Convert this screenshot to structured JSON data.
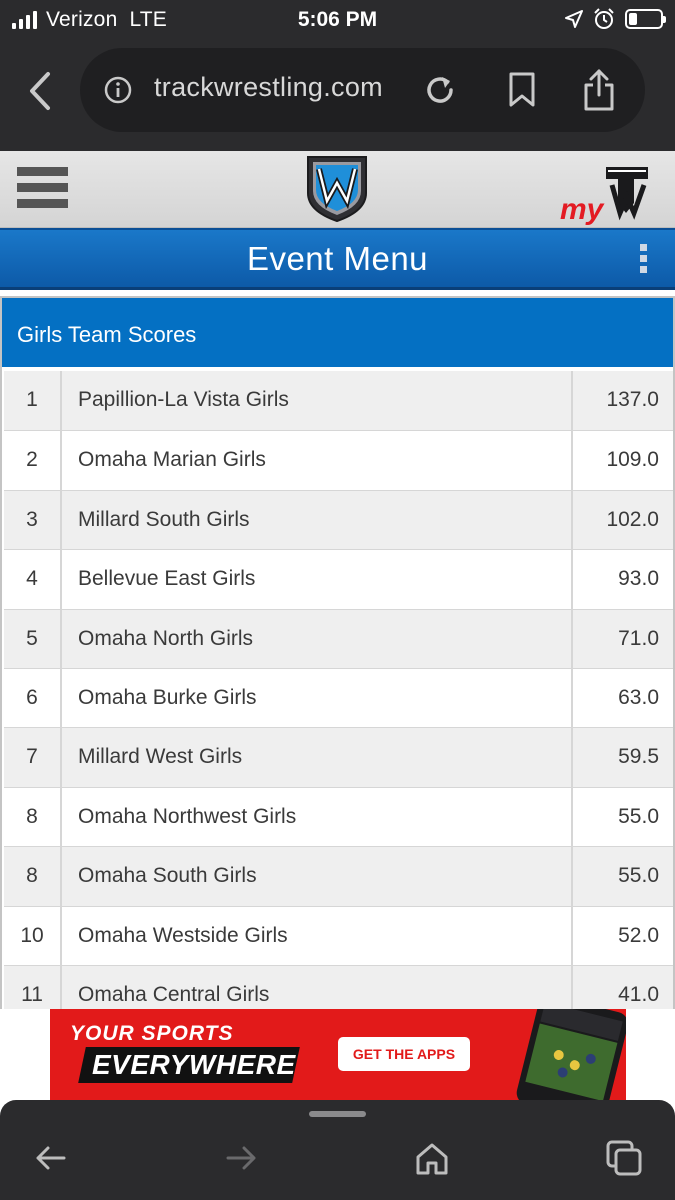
{
  "status_bar": {
    "carrier": "Verizon",
    "network": "LTE",
    "time": "5:06 PM",
    "signal_bars": 4,
    "battery_level": 0.25
  },
  "browser": {
    "url": "trackwrestling.com",
    "icons": [
      "back-icon",
      "info-icon",
      "reload-icon",
      "bookmark-icon",
      "share-icon"
    ]
  },
  "site": {
    "menu_icon": "hamburger-icon",
    "logo": "trackwrestling-w-logo",
    "my_logo": "mytw-logo",
    "event_menu_title": "Event Menu"
  },
  "panel": {
    "title": "Girls Team Scores",
    "rows": [
      {
        "rank": "1",
        "team": "Papillion-La Vista Girls",
        "score": "137.0"
      },
      {
        "rank": "2",
        "team": "Omaha Marian Girls",
        "score": "109.0"
      },
      {
        "rank": "3",
        "team": "Millard South Girls",
        "score": "102.0"
      },
      {
        "rank": "4",
        "team": "Bellevue East Girls",
        "score": "93.0"
      },
      {
        "rank": "5",
        "team": "Omaha North Girls",
        "score": "71.0"
      },
      {
        "rank": "6",
        "team": "Omaha Burke Girls",
        "score": "63.0"
      },
      {
        "rank": "7",
        "team": "Millard West Girls",
        "score": "59.5"
      },
      {
        "rank": "8",
        "team": "Omaha Northwest Girls",
        "score": "55.0"
      },
      {
        "rank": "8",
        "team": "Omaha South Girls",
        "score": "55.0"
      },
      {
        "rank": "10",
        "team": "Omaha Westside Girls",
        "score": "52.0"
      },
      {
        "rank": "11",
        "team": "Omaha Central Girls",
        "score": "41.0"
      }
    ]
  },
  "ad": {
    "line1": "YOUR SPORTS",
    "line2": "EVERYWHERE",
    "cta": "GET THE APPS"
  },
  "toolbar": {
    "icons": [
      "back-arrow-icon",
      "forward-arrow-icon",
      "home-icon",
      "tabs-icon"
    ]
  },
  "colors": {
    "chrome": "#2b2b2d",
    "event_menu_blue": "#1a78c9",
    "panel_header_blue": "#0470c3",
    "ad_red": "#e21a1a",
    "my_red": "#e31b23"
  }
}
